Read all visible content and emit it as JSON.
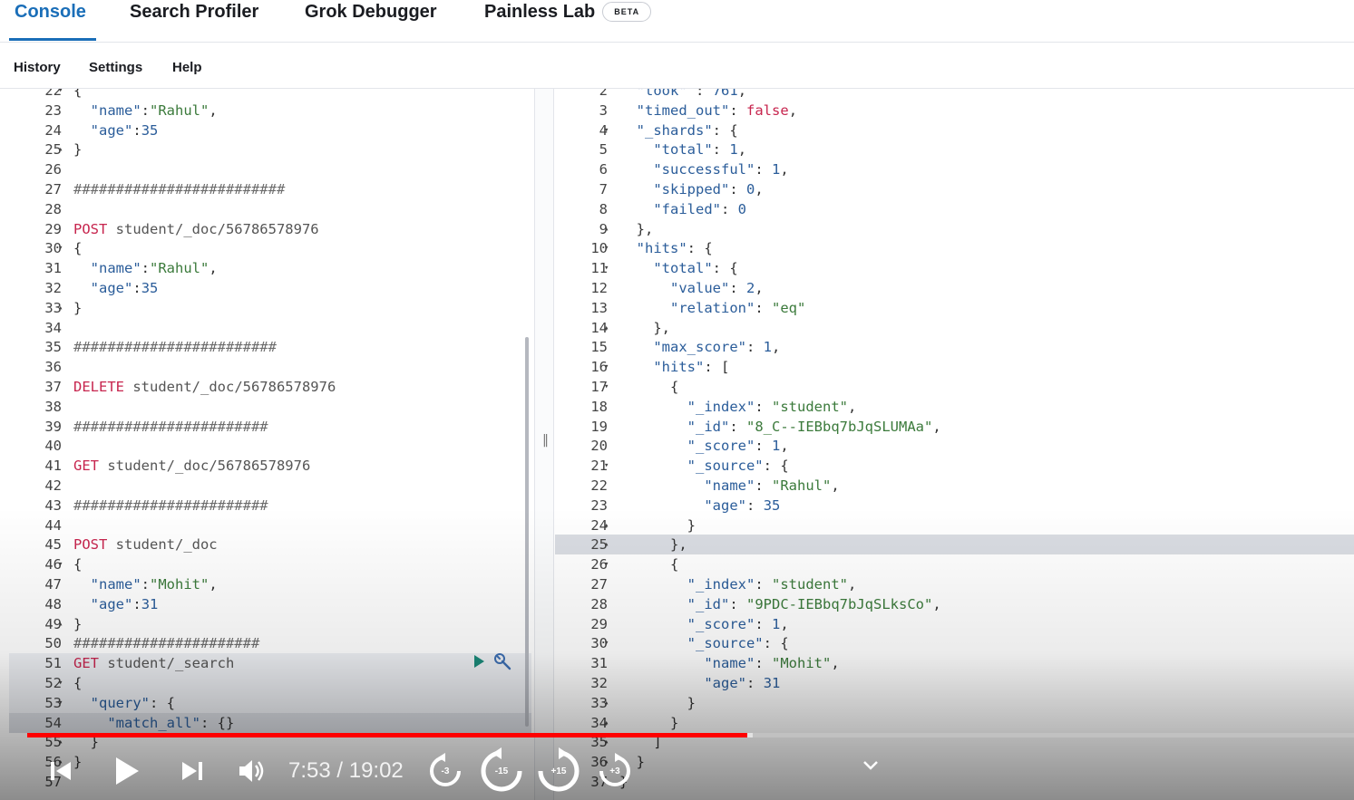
{
  "tabs": [
    {
      "label": "Console"
    },
    {
      "label": "Search Profiler"
    },
    {
      "label": "Grok Debugger"
    },
    {
      "label": "Painless Lab"
    }
  ],
  "beta_badge": "BETA",
  "subnav": {
    "history": "History",
    "settings": "Settings",
    "help": "Help"
  },
  "left_editor": {
    "lines": [
      {
        "n": "22",
        "fold": "▾",
        "text": "{"
      },
      {
        "n": "23",
        "fold": "",
        "text": "  \"name\":\"Rahul\","
      },
      {
        "n": "24",
        "fold": "",
        "text": "  \"age\":35"
      },
      {
        "n": "25",
        "fold": "▴",
        "text": "}"
      },
      {
        "n": "26",
        "fold": "",
        "text": ""
      },
      {
        "n": "27",
        "fold": "",
        "text": "#########################"
      },
      {
        "n": "28",
        "fold": "",
        "text": ""
      },
      {
        "n": "29",
        "fold": "",
        "method": "POST",
        "path": " student/_doc/56786578976"
      },
      {
        "n": "30",
        "fold": "▾",
        "text": "{"
      },
      {
        "n": "31",
        "fold": "",
        "text": "  \"name\":\"Rahul\","
      },
      {
        "n": "32",
        "fold": "",
        "text": "  \"age\":35"
      },
      {
        "n": "33",
        "fold": "▴",
        "text": "}"
      },
      {
        "n": "34",
        "fold": "",
        "text": ""
      },
      {
        "n": "35",
        "fold": "",
        "text": "########################"
      },
      {
        "n": "36",
        "fold": "",
        "text": ""
      },
      {
        "n": "37",
        "fold": "",
        "method": "DELETE",
        "path": " student/_doc/56786578976"
      },
      {
        "n": "38",
        "fold": "",
        "text": ""
      },
      {
        "n": "39",
        "fold": "",
        "text": "#######################"
      },
      {
        "n": "40",
        "fold": "",
        "text": ""
      },
      {
        "n": "41",
        "fold": "",
        "method": "GET",
        "path": " student/_doc/56786578976"
      },
      {
        "n": "42",
        "fold": "",
        "text": ""
      },
      {
        "n": "43",
        "fold": "",
        "text": "#######################"
      },
      {
        "n": "44",
        "fold": "",
        "text": ""
      },
      {
        "n": "45",
        "fold": "",
        "method": "POST",
        "path": " student/_doc"
      },
      {
        "n": "46",
        "fold": "▾",
        "text": "{"
      },
      {
        "n": "47",
        "fold": "",
        "text": "  \"name\":\"Mohit\","
      },
      {
        "n": "48",
        "fold": "",
        "text": "  \"age\":31"
      },
      {
        "n": "49",
        "fold": "▴",
        "text": "}"
      },
      {
        "n": "50",
        "fold": "",
        "text": "######################"
      },
      {
        "n": "51",
        "fold": "",
        "method": "GET",
        "path": " student/_search"
      },
      {
        "n": "52",
        "fold": "▾",
        "text": "{"
      },
      {
        "n": "53",
        "fold": "▾",
        "text": "  \"query\": {"
      },
      {
        "n": "54",
        "fold": "",
        "text": "    \"match_all\": {}"
      },
      {
        "n": "55",
        "fold": "▴",
        "text": "  }"
      },
      {
        "n": "56",
        "fold": "▴",
        "text": "}"
      },
      {
        "n": "57",
        "fold": "",
        "text": ""
      }
    ]
  },
  "right_editor": {
    "lines": [
      {
        "n": "2",
        "fold": "",
        "text": "  \"took\" : 761,"
      },
      {
        "n": "3",
        "fold": "",
        "text": "  \"timed_out\": false,"
      },
      {
        "n": "4",
        "fold": "▾",
        "text": "  \"_shards\": {"
      },
      {
        "n": "5",
        "fold": "",
        "text": "    \"total\": 1,"
      },
      {
        "n": "6",
        "fold": "",
        "text": "    \"successful\": 1,"
      },
      {
        "n": "7",
        "fold": "",
        "text": "    \"skipped\": 0,"
      },
      {
        "n": "8",
        "fold": "",
        "text": "    \"failed\": 0"
      },
      {
        "n": "9",
        "fold": "▴",
        "text": "  },"
      },
      {
        "n": "10",
        "fold": "▾",
        "text": "  \"hits\": {"
      },
      {
        "n": "11",
        "fold": "▾",
        "text": "    \"total\": {"
      },
      {
        "n": "12",
        "fold": "",
        "text": "      \"value\": 2,"
      },
      {
        "n": "13",
        "fold": "",
        "text": "      \"relation\": \"eq\""
      },
      {
        "n": "14",
        "fold": "▴",
        "text": "    },"
      },
      {
        "n": "15",
        "fold": "",
        "text": "    \"max_score\": 1,"
      },
      {
        "n": "16",
        "fold": "▾",
        "text": "    \"hits\": ["
      },
      {
        "n": "17",
        "fold": "▾",
        "text": "      {"
      },
      {
        "n": "18",
        "fold": "",
        "text": "        \"_index\": \"student\","
      },
      {
        "n": "19",
        "fold": "",
        "text": "        \"_id\": \"8_C--IEBbq7bJqSLUMAa\","
      },
      {
        "n": "20",
        "fold": "",
        "text": "        \"_score\": 1,"
      },
      {
        "n": "21",
        "fold": "▾",
        "text": "        \"_source\": {"
      },
      {
        "n": "22",
        "fold": "",
        "text": "          \"name\": \"Rahul\","
      },
      {
        "n": "23",
        "fold": "",
        "text": "          \"age\": 35"
      },
      {
        "n": "24",
        "fold": "▴",
        "text": "        }"
      },
      {
        "n": "25",
        "fold": "▴",
        "text": "      },"
      },
      {
        "n": "26",
        "fold": "▾",
        "text": "      {"
      },
      {
        "n": "27",
        "fold": "",
        "text": "        \"_index\": \"student\","
      },
      {
        "n": "28",
        "fold": "",
        "text": "        \"_id\": \"9PDC-IEBbq7bJqSLksCo\","
      },
      {
        "n": "29",
        "fold": "",
        "text": "        \"_score\": 1,"
      },
      {
        "n": "30",
        "fold": "▾",
        "text": "        \"_source\": {"
      },
      {
        "n": "31",
        "fold": "",
        "text": "          \"name\": \"Mohit\","
      },
      {
        "n": "32",
        "fold": "",
        "text": "          \"age\": 31"
      },
      {
        "n": "33",
        "fold": "▴",
        "text": "        }"
      },
      {
        "n": "34",
        "fold": "▴",
        "text": "      }"
      },
      {
        "n": "35",
        "fold": "▴",
        "text": "    ]"
      },
      {
        "n": "36",
        "fold": "▴",
        "text": "  }"
      },
      {
        "n": "37",
        "fold": "▴",
        "text": "}"
      }
    ]
  },
  "video": {
    "time_display": "7:53 / 19:02",
    "progress_fraction": 0.5425,
    "buffered_fraction": 0.547,
    "skip_back_small": "-3",
    "skip_back_large": "-15",
    "skip_fwd_large": "+15",
    "skip_fwd_small": "+3",
    "accent_color": "#ff0000"
  },
  "colors": {
    "tab_active": "#1a6eb8",
    "method": "#c7254e"
  }
}
